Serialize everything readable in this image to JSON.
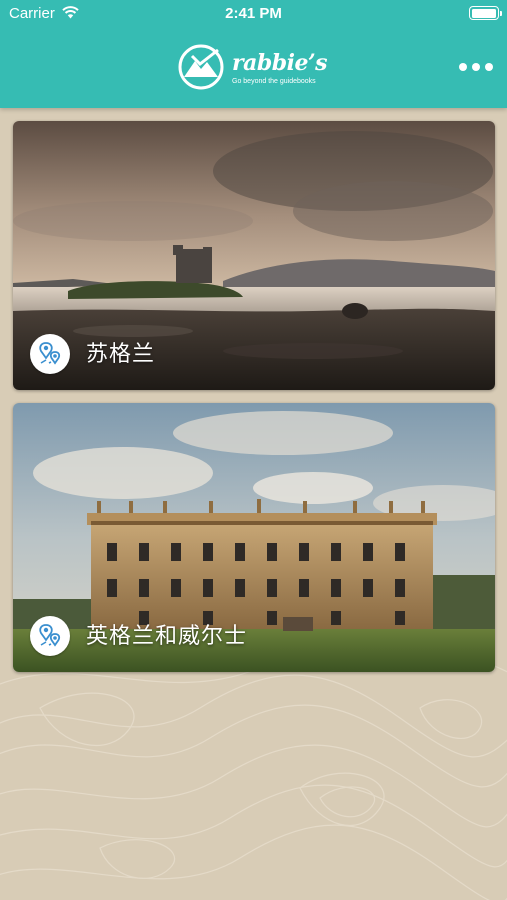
{
  "status_bar": {
    "carrier": "Carrier",
    "time": "2:41 PM"
  },
  "header": {
    "brand_name": "rabbie’s",
    "tagline": "Go beyond the guidebooks",
    "menu_icon": "more-dots-icon",
    "bar_color": "#36bcb3"
  },
  "destinations": [
    {
      "label": "苏格兰",
      "icon": "map-pin-icon"
    },
    {
      "label": "英格兰和威尔士",
      "icon": "map-pin-icon"
    }
  ],
  "colors": {
    "background": "#d8ccb6",
    "pin_icon": "#3a8fcf"
  }
}
